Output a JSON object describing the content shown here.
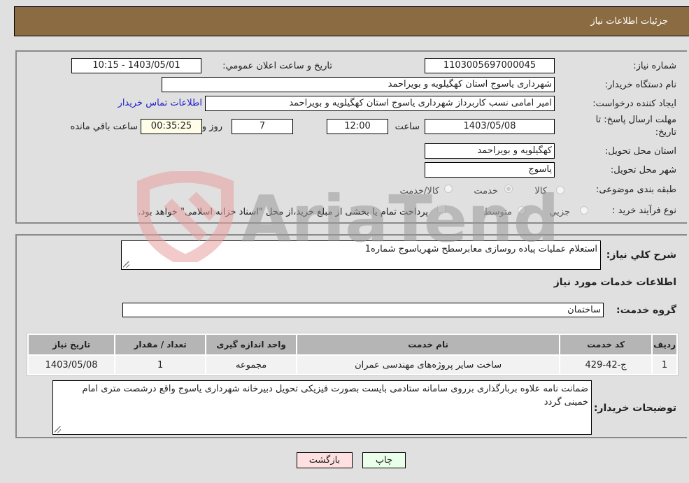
{
  "header": {
    "title": "جزئيات اطلاعات نياز"
  },
  "form": {
    "need_number_label": "شماره نیاز:",
    "need_number": "1103005697000045",
    "announce_label": "تاريخ و ساعت اعلان عمومي:",
    "announce_value": "1403/05/01 - 10:15",
    "buyer_org_label": "نام دستگاه خریدار:",
    "buyer_org": "شهرداری یاسوج استان کهگیلویه و بویراحمد",
    "requester_label": "ایجاد کننده درخواست:",
    "requester": "امیر امامی نسب کاربرداز شهرداری یاسوج استان کهگیلویه و بویراحمد",
    "contact_link": "اطلاعات تماس خریدار",
    "deadline_label_1": "مهلت ارسال پاسخ: تا",
    "deadline_label_2": "تاریخ:",
    "deadline_date": "1403/05/08",
    "time_label": "ساعت",
    "deadline_time": "12:00",
    "days_value": "7",
    "days_label": "روز و",
    "remaining_time": "00:35:25",
    "remaining_label": "ساعت باقي مانده",
    "province_label": "استان محل تحویل:",
    "province": "کهگیلویه و بویراحمد",
    "city_label": "شهر محل تحویل:",
    "city": "یاسوج",
    "category_label": "طبقه بندی موضوعی:",
    "category_options": [
      "کالا",
      "خدمت",
      "کالا/خدمت"
    ],
    "category_selected": "خدمت",
    "process_label": "نوع فرآیند خرید :",
    "process_options": [
      "جزيي",
      "متوسط"
    ],
    "treasury_note": "پرداخت تمام یا بخشی از مبلغ خرید،از محل \"اسناد خزانه اسلامی\" خواهد بود."
  },
  "details": {
    "summary_label": "شرح كلي نياز:",
    "summary": "استعلام عملیات پیاده روسازی معابرسطح شهریاسوج شماره1",
    "services_heading": "اطلاعات خدمات مورد نياز",
    "service_group_label": "گروه خدمت:",
    "service_group": "ساختمان",
    "table": {
      "headers": [
        "ردیف",
        "کد خدمت",
        "نام خدمت",
        "واحد اندازه گیری",
        "تعداد / مقدار",
        "تاریخ نیاز"
      ],
      "rows": [
        [
          "1",
          "ج-42-429",
          "ساخت سایر پروژه‌های مهندسی عمران",
          "مجموعه",
          "1",
          "1403/05/08"
        ]
      ]
    },
    "buyer_notes_label": "توضيحات خريدار:",
    "buyer_notes": "ضمانت نامه علاوه بربارگذاری برروی سامانه ستادمی بایست بصورت فیزیکی تحویل دبیرخانه شهرداری یاسوج واقع درشصت متری امام خمینی گردد"
  },
  "buttons": {
    "print": "چاپ",
    "back": "بازگشت"
  },
  "watermark": {
    "text": "AriaTender.neT"
  },
  "colors": {
    "header": "#8b6c42",
    "print_bg": "#eaffea",
    "back_bg": "#ffe0e0",
    "link": "#2222cc"
  }
}
